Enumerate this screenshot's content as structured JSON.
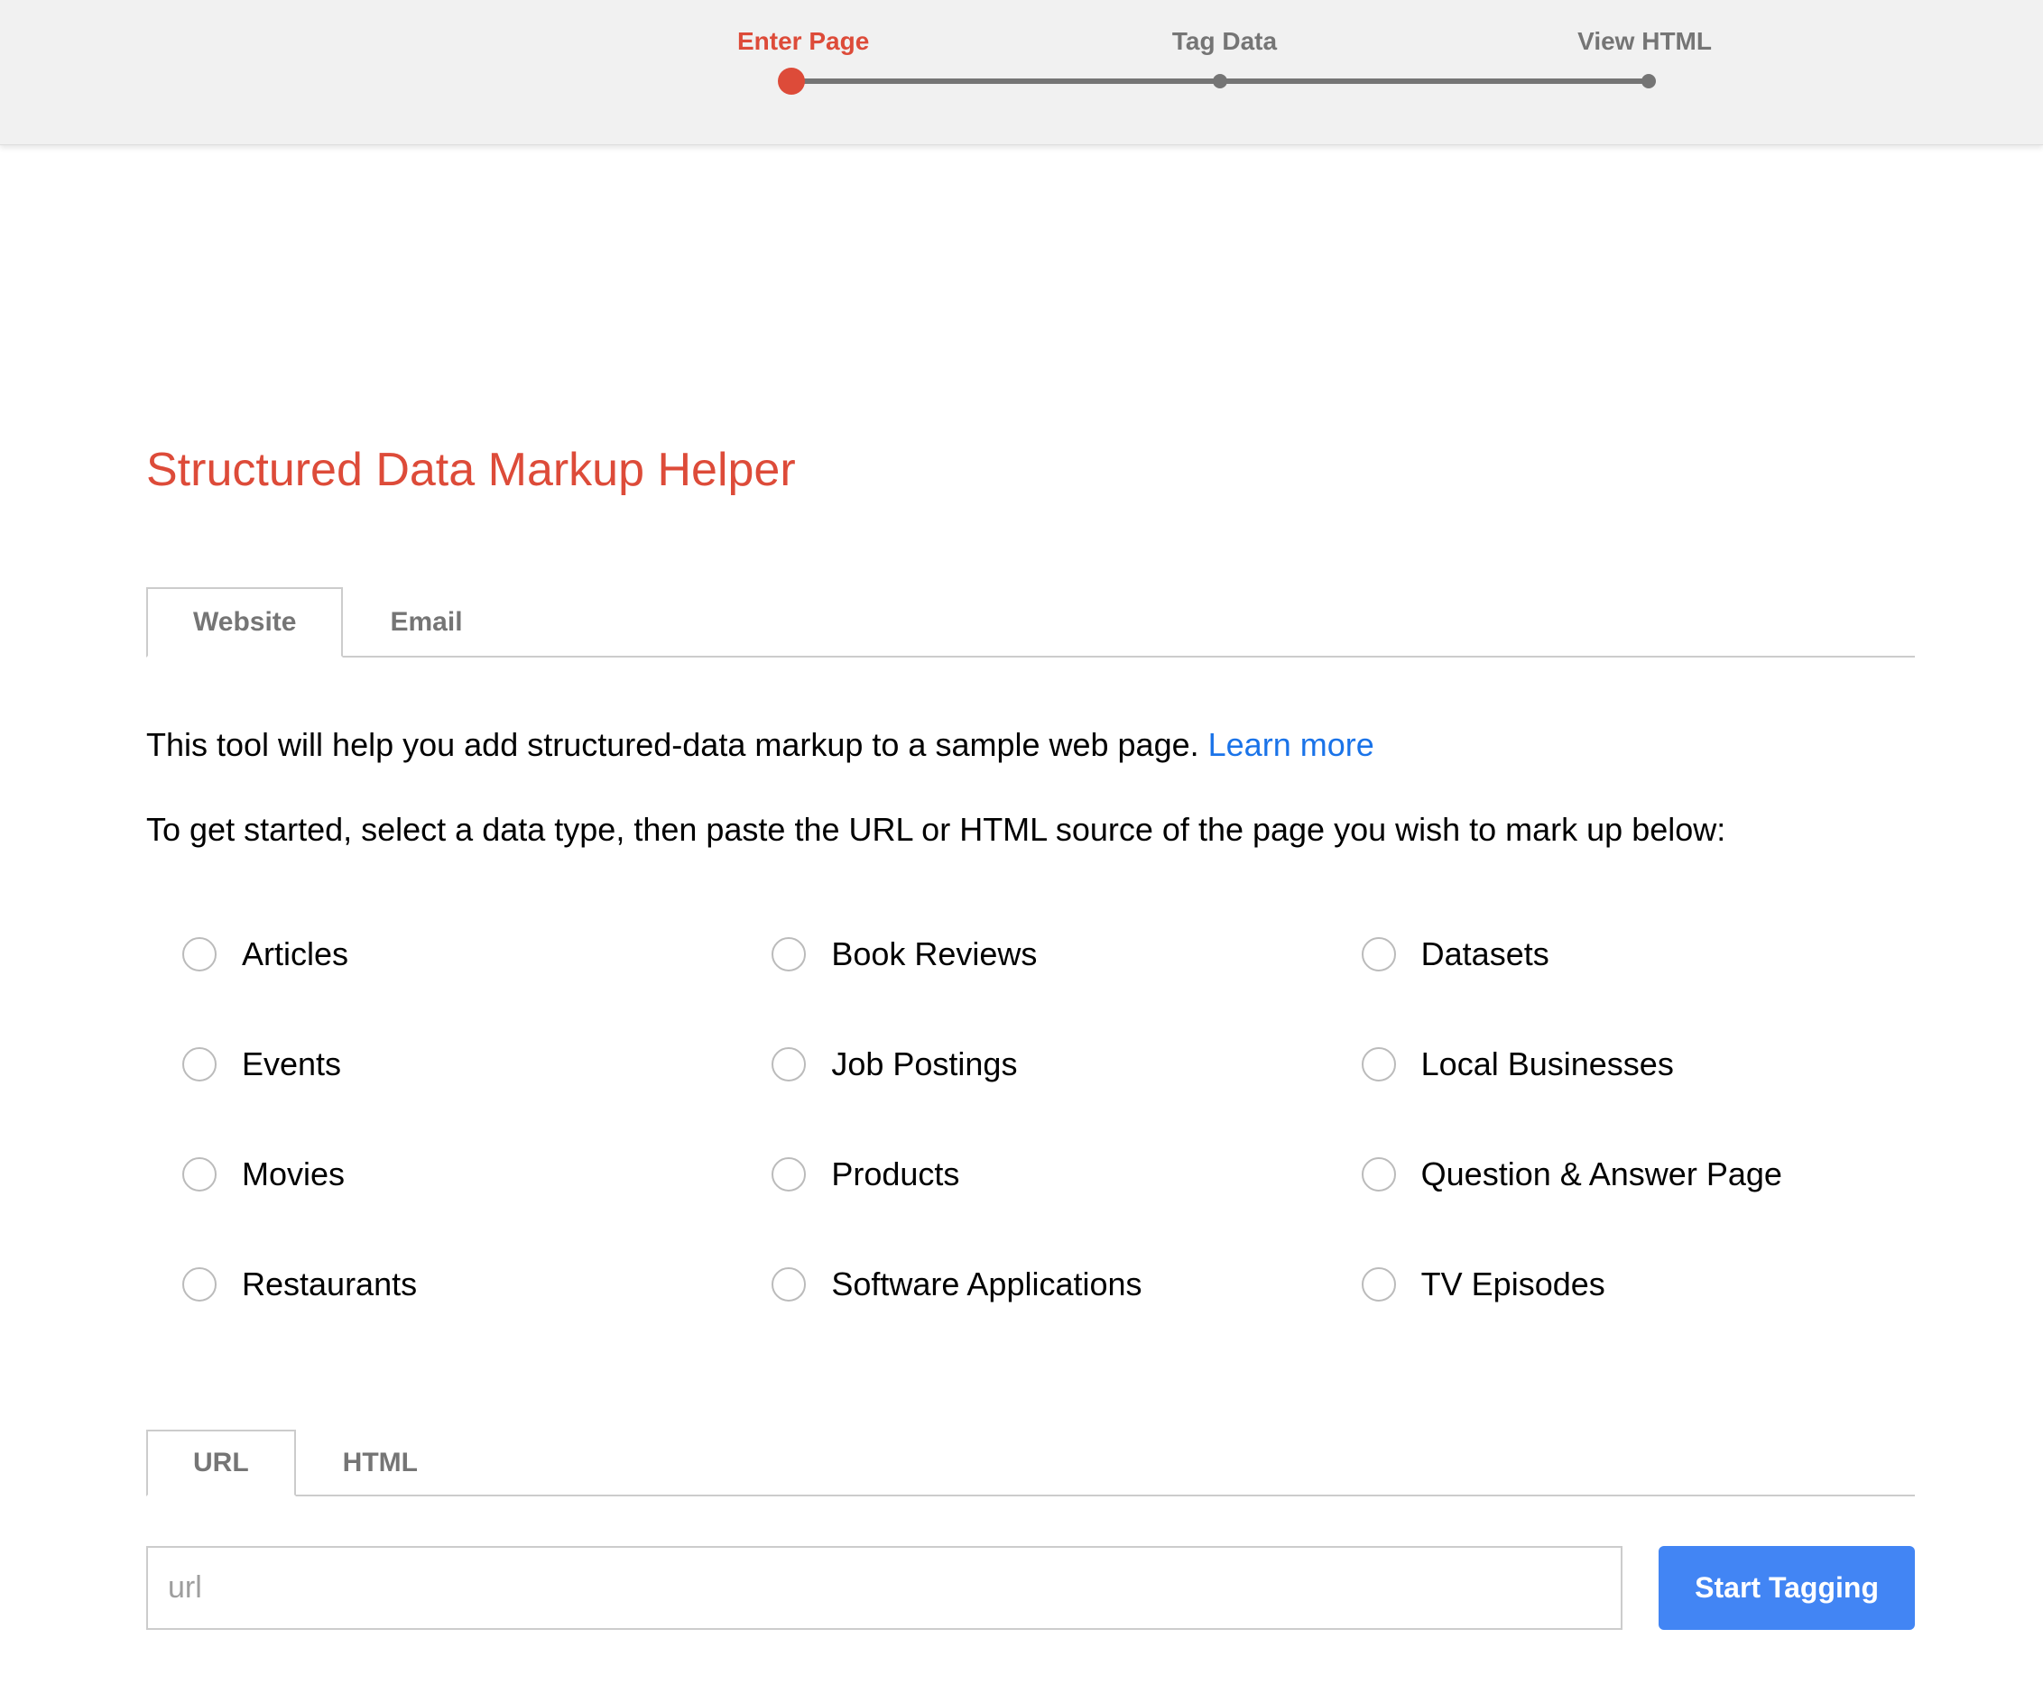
{
  "stepper": {
    "steps": [
      {
        "label": "Enter Page",
        "active": true
      },
      {
        "label": "Tag Data",
        "active": false
      },
      {
        "label": "View HTML",
        "active": false
      }
    ]
  },
  "page": {
    "title": "Structured Data Markup Helper"
  },
  "tabs": {
    "source": [
      {
        "label": "Website",
        "active": true
      },
      {
        "label": "Email",
        "active": false
      }
    ],
    "input": [
      {
        "label": "URL",
        "active": true
      },
      {
        "label": "HTML",
        "active": false
      }
    ]
  },
  "description": {
    "text": "This tool will help you add structured-data markup to a sample web page. ",
    "learn_more": "Learn more"
  },
  "instructions": "To get started, select a data type, then paste the URL or HTML source of the page you wish to mark up below:",
  "data_types": [
    "Articles",
    "Book Reviews",
    "Datasets",
    "Events",
    "Job Postings",
    "Local Businesses",
    "Movies",
    "Products",
    "Question & Answer Page",
    "Restaurants",
    "Software Applications",
    "TV Episodes"
  ],
  "url_input": {
    "placeholder": "url",
    "value": ""
  },
  "buttons": {
    "start": "Start Tagging"
  }
}
